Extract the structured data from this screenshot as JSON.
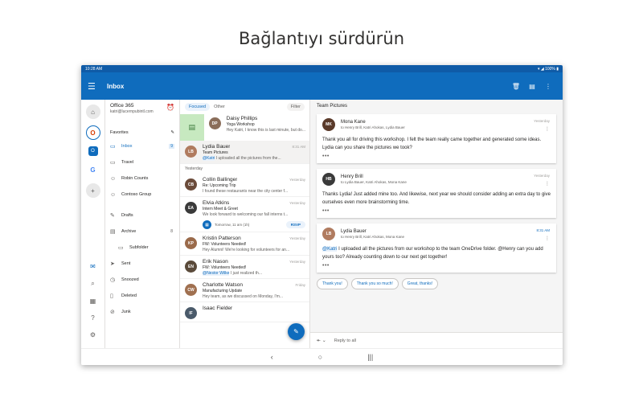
{
  "headline": "Bağlantıyı sürdürün",
  "status": {
    "time": "10:28 AM",
    "right": "▾ ◢ 100% ▮"
  },
  "appbar": {
    "title": "Inbox"
  },
  "account": {
    "name": "Office 365",
    "email": "katri@lucernpubintl.com"
  },
  "favorites_label": "Favorites",
  "folders": [
    {
      "label": "Inbox",
      "icon": "inbox-icon",
      "glyph": "▭",
      "count": "9",
      "selected": true
    },
    {
      "label": "Travel",
      "icon": "folder-icon",
      "glyph": "▭",
      "count": ""
    },
    {
      "label": "Robin Counts",
      "icon": "person-icon",
      "glyph": "☺",
      "count": ""
    },
    {
      "label": "Contoso Group",
      "icon": "group-icon",
      "glyph": "☺",
      "count": ""
    }
  ],
  "folders2": [
    {
      "label": "Drafts",
      "icon": "pencil-icon",
      "glyph": "✎",
      "count": ""
    },
    {
      "label": "Archive",
      "icon": "archive-icon",
      "glyph": "▤",
      "count": "8"
    },
    {
      "label": "Subfolder",
      "icon": "folder-icon",
      "glyph": "▭",
      "count": "",
      "sub": true
    },
    {
      "label": "Sent",
      "icon": "send-icon",
      "glyph": "➤",
      "count": ""
    },
    {
      "label": "Snoozed",
      "icon": "clock-icon",
      "glyph": "◷",
      "count": ""
    },
    {
      "label": "Deleted",
      "icon": "trash-icon",
      "glyph": "▯",
      "count": ""
    },
    {
      "label": "Junk",
      "icon": "junk-icon",
      "glyph": "⊘",
      "count": ""
    }
  ],
  "list": {
    "tab_focused": "Focused",
    "tab_other": "Other",
    "filter": "Filter",
    "yesterday": "Yesterday",
    "swiped": {
      "from": "Daisy Phillips",
      "subject": "Yoga Workshop",
      "preview": "Hey Katri, I know this is last minute, but do...",
      "color": "#8a6d5a"
    },
    "selected": {
      "from": "Lydia Bauer",
      "time": "8:31 AM",
      "subject": "Team Pictures",
      "mention": "@Katri",
      "preview": " I uploaded all the pictures from the...",
      "color": "#b07b5f"
    },
    "messages": [
      {
        "from": "Collin Ballinger",
        "time": "Yesterday",
        "subject": "Re: Upcoming Trip",
        "preview": "I found these restaurants near the city center f...",
        "color": "#6b4b3a"
      },
      {
        "from": "Elvia Atkins",
        "time": "Yesterday",
        "subject": "Intern Meet & Greet",
        "preview": "We look forward to welcoming our fall interns t...",
        "color": "#3a3a3a",
        "event": {
          "when": "Tomorrow, 11 am (1h)",
          "rsvp": "RSVP"
        }
      },
      {
        "from": "Kristin Patterson",
        "time": "Yesterday",
        "subject": "FW: Volunteers Needed!",
        "preview": "Hey Alumni! We're looking for volunteers for an...",
        "color": "#9a6a4a"
      },
      {
        "from": "Erik Nason",
        "time": "Yesterday",
        "subject": "FW: Volunteers Needed!",
        "mention": "@Nestor Wilke",
        "preview": " I just realized th...",
        "color": "#5a4a3a"
      },
      {
        "from": "Charlotte Watson",
        "time": "Friday",
        "subject": "Manufacturing Update",
        "preview": "Hey team, as we discussed on Monday, I'm...",
        "color": "#a07050"
      },
      {
        "from": "Isaac Fielder",
        "time": "",
        "subject": "",
        "preview": "",
        "color": "#4a5a6a"
      }
    ]
  },
  "reading": {
    "subject": "Team Pictures",
    "cards": [
      {
        "from": "Mona Kane",
        "to": "to Henry Brill, Katri Ahokas, Lydia Bauer",
        "time": "Yesterday",
        "body_pre": "Thank you all for driving this workshop. I felt the team really came together and generated some ideas. Lydia can you share the pictures we took?",
        "body_mention": "",
        "body_post": "",
        "color": "#5a3a2a"
      },
      {
        "from": "Henry Brill",
        "to": "to Lydia Bauer, Katri Ahokas, Mona Kane",
        "time": "Yesterday",
        "body_pre": "Thanks Lydia! Just added mine too. And likewise, next year we should consider adding an extra day to give ourselves even more brainstorming time.",
        "body_mention": "",
        "body_post": "",
        "color": "#3a3a3a"
      },
      {
        "from": "Lydia Bauer",
        "to": "to Henry Brill, Katri Ahokas, Mona Kane",
        "time": "8:31 AM",
        "body_pre": "",
        "body_mention": "@Katri",
        "body_post": " I uploaded all the pictures from our workshop to the team OneDrive folder. @Henry can you add yours too? Already counting down to our next get together!",
        "color": "#b07b5f"
      }
    ],
    "quick_replies": [
      "Thank you!",
      "Thank you so much!",
      "Great, thanks!"
    ],
    "reply_all": "Reply to all"
  }
}
